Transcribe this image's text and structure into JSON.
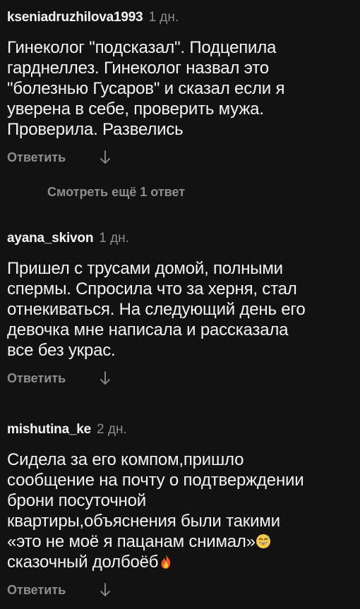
{
  "comments": [
    {
      "username": "kseniadruzhilova1993",
      "age": "1 дн.",
      "text": "Гинеколог \"подсказал\". Подцепила\nгарднеллез. Гинеколог назвал это\n\"болезнью Гусаров\" и сказал если я\nуверена в себе, проверить мужа.\nПроверила. Развелись",
      "reply_label": "Ответить",
      "arrow_icon": "arrow-down-icon"
    },
    {
      "username": "ayana_skivon",
      "age": "1 дн.",
      "text": "Пришел с трусами домой, полными\nспермы. Спросила что за херня, стал\nотнекиваться. На следующий день его\nдевочка мне написала и рассказала\nвсе без украс.",
      "reply_label": "Ответить",
      "arrow_icon": "arrow-down-icon"
    },
    {
      "username": "mishutina_ke",
      "age": "2 дн.",
      "text_lines": [
        "Сидела за его компом,пришло",
        "сообщение на почту о подтверждении",
        "брони посуточной",
        "квартиры,объяснения были такими",
        "«это не моё я пацанам снимал»",
        "сказочный долбоёб"
      ],
      "emoji_1": "grinning-sweat-emoji",
      "emoji_2": "fire-emoji",
      "reply_label": "Ответить",
      "arrow_icon": "arrow-down-icon"
    }
  ],
  "view_more_replies": "Смотреть ещё 1 ответ",
  "colors": {
    "background": "#121212",
    "primary_text": "#f5f5f5",
    "secondary_text": "#8e8e8e"
  }
}
